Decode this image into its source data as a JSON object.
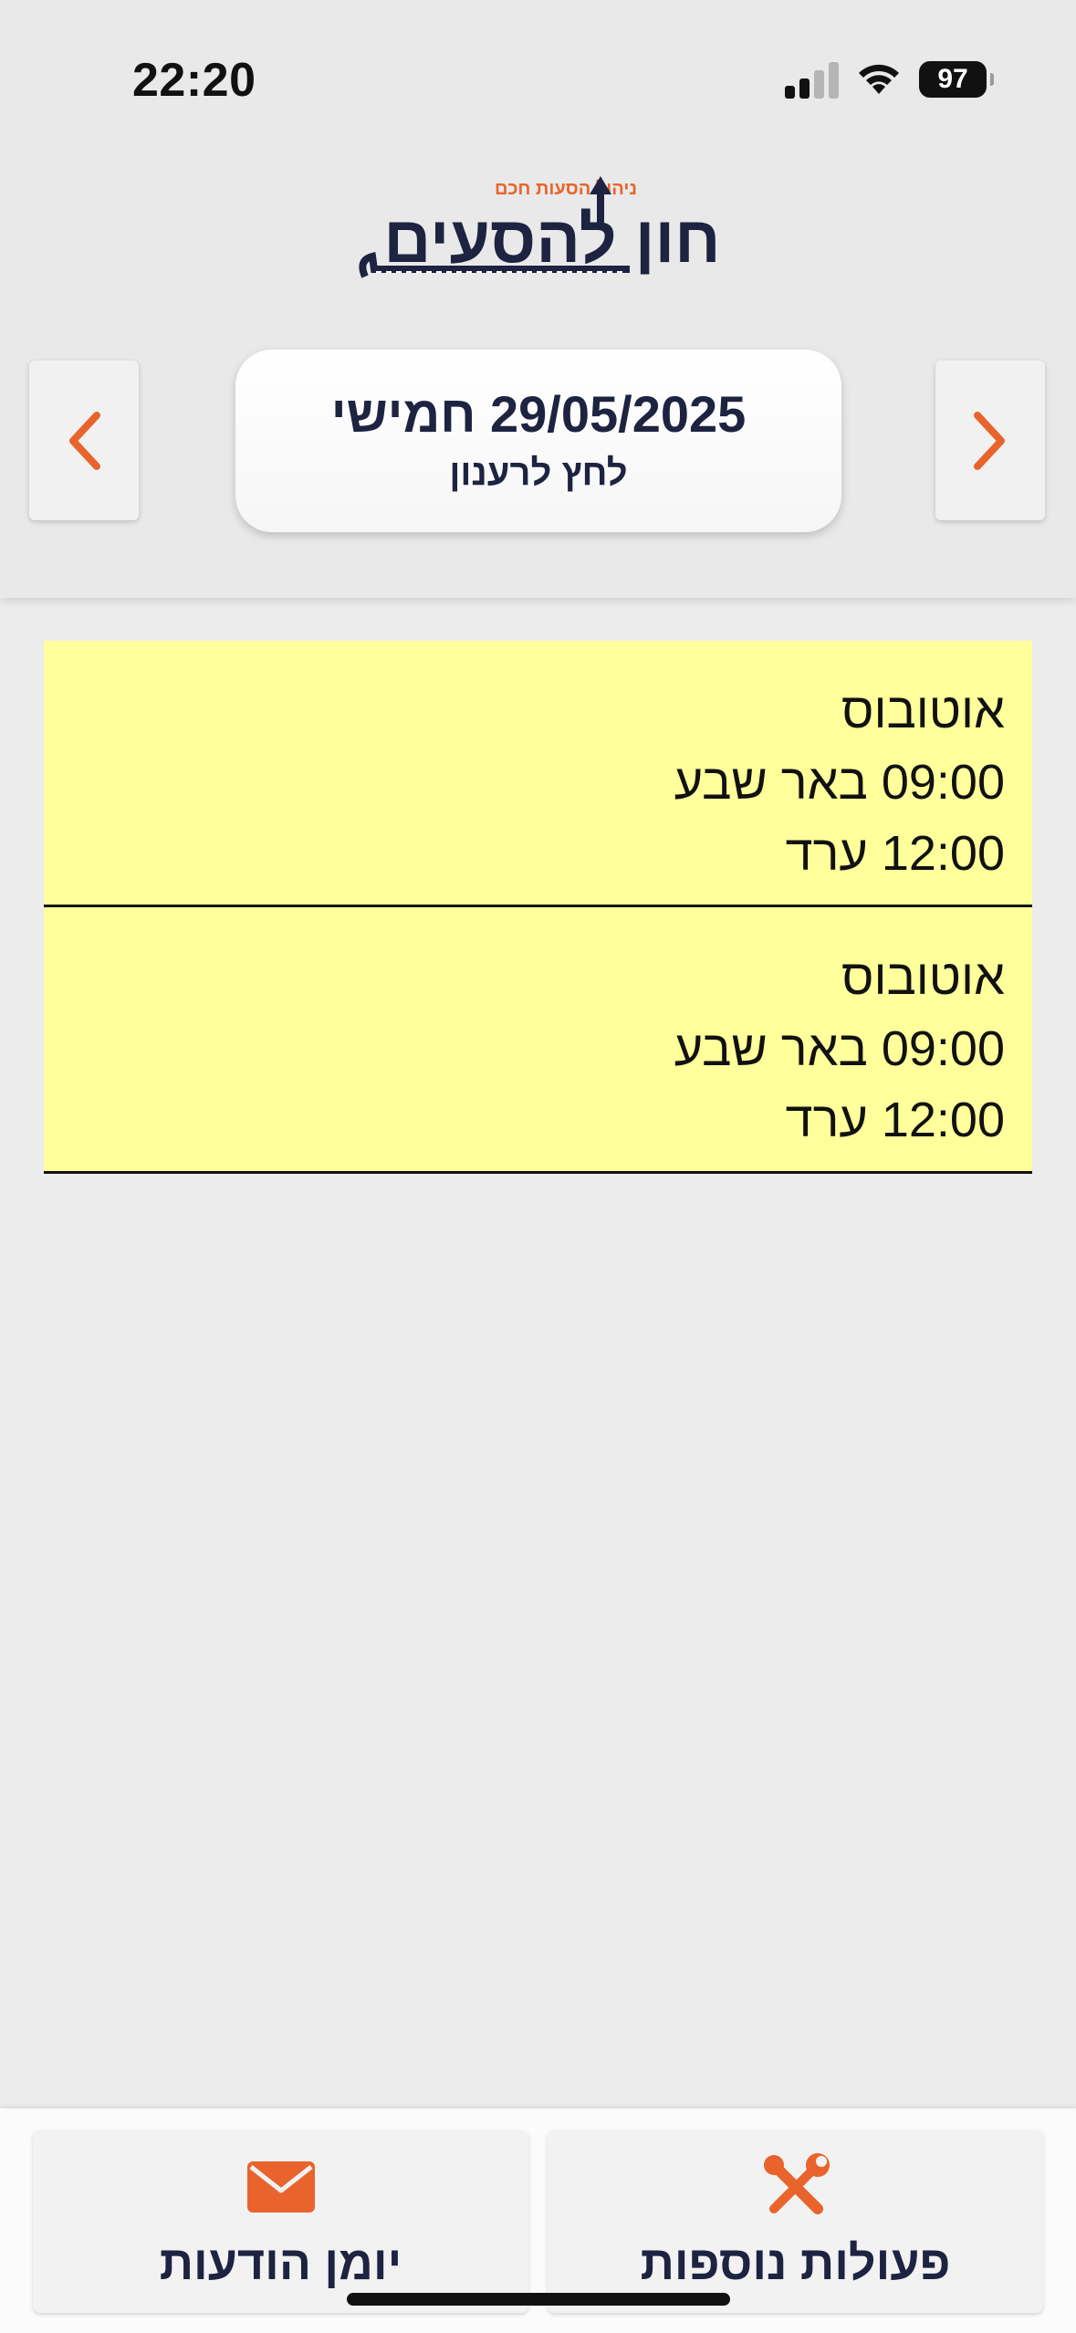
{
  "status_bar": {
    "time": "22:20",
    "battery": "97"
  },
  "logo": {
    "name": "חון להסעים",
    "tagline": "ניהול הסעות חכם"
  },
  "header": {
    "date_label": "29/05/2025 חמישי",
    "refresh_hint": "לחץ לרענון"
  },
  "trips": [
    {
      "vehicle": "אוטובוס",
      "departure": "09:00 באר שבע",
      "arrival": "12:00 ערד"
    },
    {
      "vehicle": "אוטובוס",
      "departure": "09:00 באר שבע",
      "arrival": "12:00 ערד"
    }
  ],
  "bottom_nav": {
    "messages_label": "יומן הודעות",
    "actions_label": "פעולות נוספות"
  },
  "colors": {
    "accent": "#e8642c",
    "navy": "#1d2340",
    "trip_bg": "#ffff9b"
  }
}
